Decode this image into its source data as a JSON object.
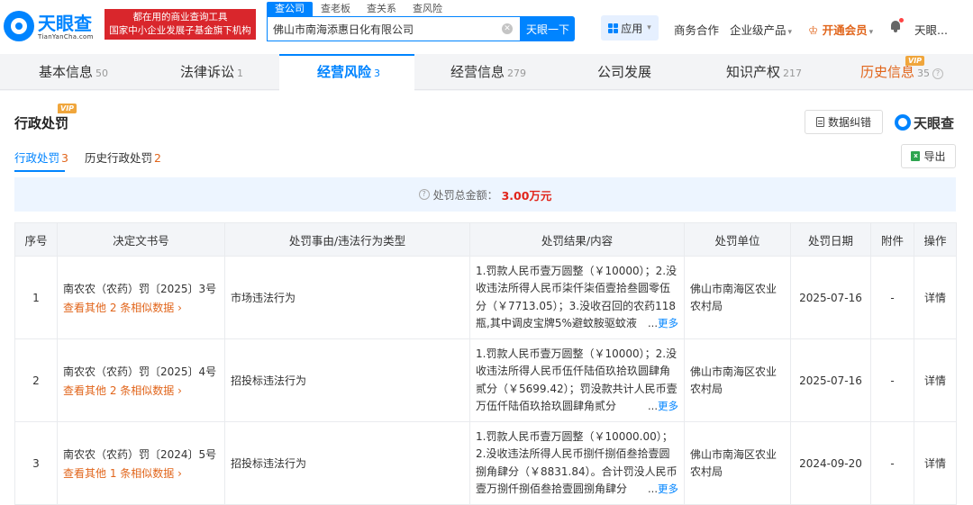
{
  "brand": {
    "name": "天眼查",
    "subname": "TianYanCha.com",
    "slogan_line1": "都在用的商业查询工具",
    "slogan_line2": "国家中小企业发展子基金旗下机构"
  },
  "search": {
    "tabs": [
      "查公司",
      "查老板",
      "查关系",
      "查风险"
    ],
    "value": "佛山市南海添惠日化有限公司",
    "button": "天眼一下"
  },
  "nav": {
    "app": "应用",
    "business": "商务合作",
    "enterprise": "企业级产品",
    "vip": "开通会员",
    "user": "天眼..."
  },
  "tabs": [
    {
      "label": "基本信息",
      "count": "50"
    },
    {
      "label": "法律诉讼",
      "count": "1"
    },
    {
      "label": "经营风险",
      "count": "3"
    },
    {
      "label": "经营信息",
      "count": "279"
    },
    {
      "label": "公司发展",
      "count": ""
    },
    {
      "label": "知识产权",
      "count": "217"
    },
    {
      "label": "历史信息",
      "count": "35"
    }
  ],
  "vip_tag": "VIP",
  "section": {
    "title": "行政处罚",
    "data_fix": "数据纠错",
    "watermark": "天眼查",
    "export": "导出",
    "subtabs": [
      {
        "label": "行政处罚",
        "count": "3"
      },
      {
        "label": "历史行政处罚",
        "count": "2"
      }
    ],
    "summary_label": "处罚总金额：",
    "summary_amount": "3.00万元"
  },
  "table": {
    "headers": [
      "序号",
      "决定文书号",
      "处罚事由/违法行为类型",
      "处罚结果/内容",
      "处罚单位",
      "处罚日期",
      "附件",
      "操作"
    ],
    "more_label": "更多",
    "rows": [
      {
        "index": "1",
        "doc_no": "南农农（农药）罚〔2025〕3号",
        "similar": "查看其他 2 条相似数据",
        "reason": "市场违法行为",
        "content": "1.罚款人民币壹万圆整（￥10000）；2.没收违法所得人民币柒仟柒佰壹拾叁圆零伍分（￥7713.05）；3.没收召回的农药118瓶,其中调皮宝牌5%避蚊胺驱蚊液",
        "unit": "佛山市南海区农业农村局",
        "date": "2025-07-16",
        "attachment": "-",
        "action": "详情"
      },
      {
        "index": "2",
        "doc_no": "南农农（农药）罚〔2025〕4号",
        "similar": "查看其他 2 条相似数据",
        "reason": "招投标违法行为",
        "content": "1.罚款人民币壹万圆整（￥10000）；2.没收违法所得人民币伍仟陆佰玖拾玖圆肆角贰分（￥5699.42）；罚没款共计人民币壹万伍仟陆佰玖拾玖圆肆角贰分",
        "unit": "佛山市南海区农业农村局",
        "date": "2025-07-16",
        "attachment": "-",
        "action": "详情"
      },
      {
        "index": "3",
        "doc_no": "南农农（农药）罚〔2024〕5号",
        "similar": "查看其他 1 条相似数据",
        "reason": "招投标违法行为",
        "content": "1.罚款人民币壹万圆整（￥10000.00）；2.没收违法所得人民币捌仟捌佰叁拾壹圆捌角肆分（￥8831.84）。合计罚没人民币壹万捌仟捌佰叁拾壹圆捌角肆分",
        "unit": "佛山市南海区农业农村局",
        "date": "2024-09-20",
        "attachment": "-",
        "action": "详情"
      }
    ]
  },
  "colors": {
    "primary": "#0084ff",
    "accent": "#e1651b",
    "danger": "#e1251b"
  }
}
